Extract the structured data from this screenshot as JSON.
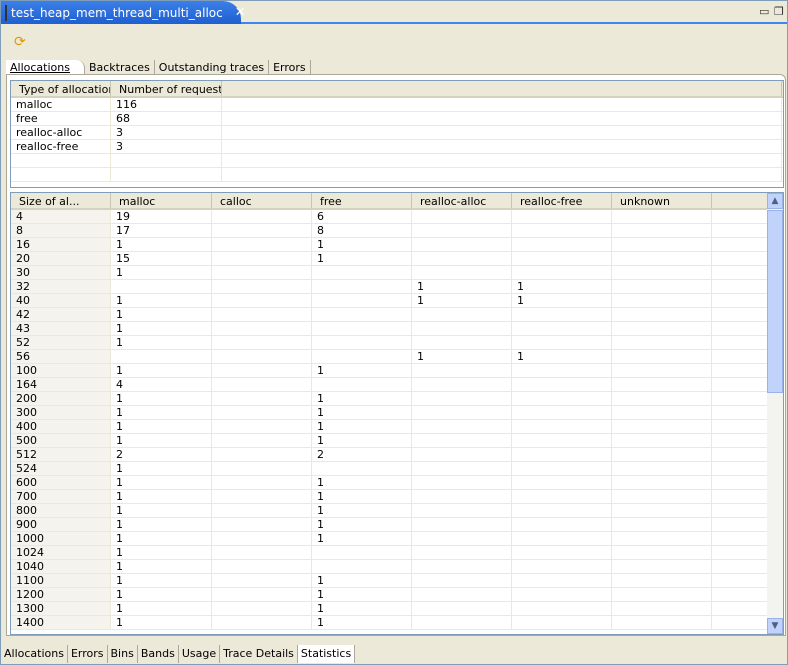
{
  "editor": {
    "title": "test_heap_mem_thread_multi_alloc",
    "close": "✕",
    "minimize": "▭",
    "restore": "❐",
    "refresh_icon": "refresh-icon"
  },
  "inner_tabs": [
    "Allocations",
    "Backtraces",
    "Outstanding traces",
    "Errors"
  ],
  "summary": {
    "columns": [
      "Type of allocation",
      "Number of requests"
    ],
    "rows": [
      [
        "malloc",
        "116"
      ],
      [
        "free",
        "68"
      ],
      [
        "realloc-alloc",
        "3"
      ],
      [
        "realloc-free",
        "3"
      ]
    ]
  },
  "detail": {
    "columns": [
      "Size of al...",
      "malloc",
      "calloc",
      "free",
      "realloc-alloc",
      "realloc-free",
      "unknown"
    ],
    "sort_indicator": "▲",
    "rows": [
      [
        "4",
        "19",
        "",
        "6",
        "",
        "",
        ""
      ],
      [
        "8",
        "17",
        "",
        "8",
        "",
        "",
        ""
      ],
      [
        "16",
        "1",
        "",
        "1",
        "",
        "",
        ""
      ],
      [
        "20",
        "15",
        "",
        "1",
        "",
        "",
        ""
      ],
      [
        "30",
        "1",
        "",
        "",
        "",
        "",
        ""
      ],
      [
        "32",
        "",
        "",
        "",
        "1",
        "1",
        ""
      ],
      [
        "40",
        "1",
        "",
        "",
        "1",
        "1",
        ""
      ],
      [
        "42",
        "1",
        "",
        "",
        "",
        "",
        ""
      ],
      [
        "43",
        "1",
        "",
        "",
        "",
        "",
        ""
      ],
      [
        "52",
        "1",
        "",
        "",
        "",
        "",
        ""
      ],
      [
        "56",
        "",
        "",
        "",
        "1",
        "1",
        ""
      ],
      [
        "100",
        "1",
        "",
        "1",
        "",
        "",
        ""
      ],
      [
        "164",
        "4",
        "",
        "",
        "",
        "",
        ""
      ],
      [
        "200",
        "1",
        "",
        "1",
        "",
        "",
        ""
      ],
      [
        "300",
        "1",
        "",
        "1",
        "",
        "",
        ""
      ],
      [
        "400",
        "1",
        "",
        "1",
        "",
        "",
        ""
      ],
      [
        "500",
        "1",
        "",
        "1",
        "",
        "",
        ""
      ],
      [
        "512",
        "2",
        "",
        "2",
        "",
        "",
        ""
      ],
      [
        "524",
        "1",
        "",
        "",
        "",
        "",
        ""
      ],
      [
        "600",
        "1",
        "",
        "1",
        "",
        "",
        ""
      ],
      [
        "700",
        "1",
        "",
        "1",
        "",
        "",
        ""
      ],
      [
        "800",
        "1",
        "",
        "1",
        "",
        "",
        ""
      ],
      [
        "900",
        "1",
        "",
        "1",
        "",
        "",
        ""
      ],
      [
        "1000",
        "1",
        "",
        "1",
        "",
        "",
        ""
      ],
      [
        "1024",
        "1",
        "",
        "",
        "",
        "",
        ""
      ],
      [
        "1040",
        "1",
        "",
        "",
        "",
        "",
        ""
      ],
      [
        "1100",
        "1",
        "",
        "1",
        "",
        "",
        ""
      ],
      [
        "1200",
        "1",
        "",
        "1",
        "",
        "",
        ""
      ],
      [
        "1300",
        "1",
        "",
        "1",
        "",
        "",
        ""
      ],
      [
        "1400",
        "1",
        "",
        "1",
        "",
        "",
        ""
      ]
    ]
  },
  "bottom_tabs": [
    "Allocations",
    "Errors",
    "Bins",
    "Bands",
    "Usage",
    "Trace Details",
    "Statistics"
  ],
  "selected_bottom_tab": "Statistics",
  "colors": {
    "accent": "#3b7fe8",
    "background": "#ece9d8"
  }
}
